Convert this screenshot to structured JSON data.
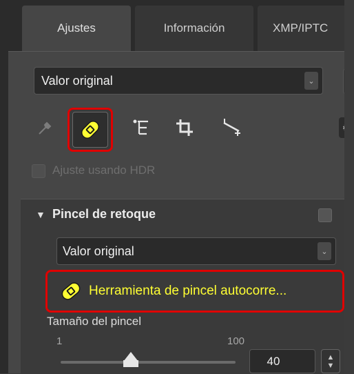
{
  "tabs": [
    {
      "label": "Ajustes"
    },
    {
      "label": "Información"
    },
    {
      "label": "XMP/IPTC"
    }
  ],
  "preset": {
    "value": "Valor original"
  },
  "hdr": {
    "label": "Ajuste usando HDR"
  },
  "section": {
    "title": "Pincel de retoque",
    "preset_value": "Valor original",
    "tool_label": "Herramienta de pincel autocorre...",
    "brush_size_label": "Tamaño del pincel",
    "range_min": "1",
    "range_max": "100",
    "brush_size_value": "40",
    "brush_size_level": 0.4
  },
  "colors": {
    "highlight": "#e00000",
    "accent_yellow": "#ffff33"
  },
  "icons": [
    "eyedropper-icon",
    "retouch-brush-icon",
    "layers-icon",
    "crop-icon",
    "straighten-icon",
    "gear-icon"
  ]
}
